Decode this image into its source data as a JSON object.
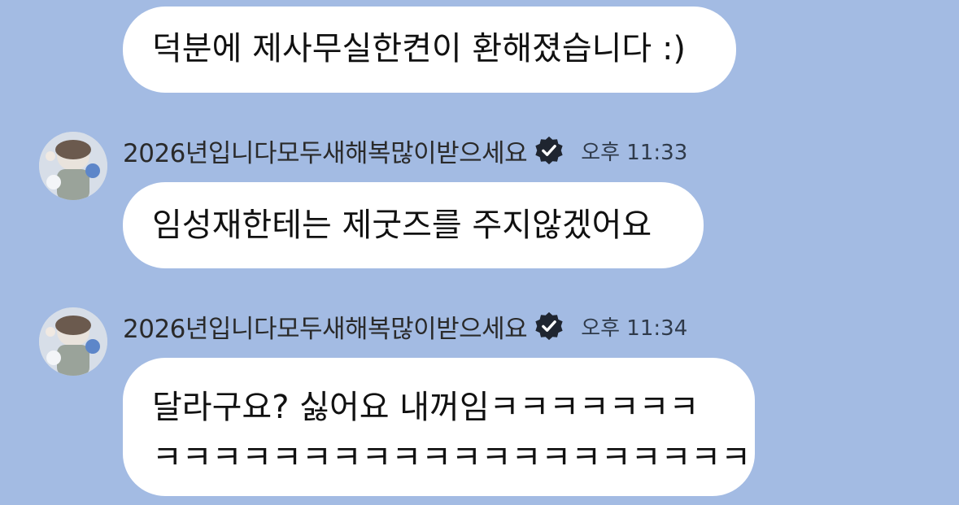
{
  "messages": [
    {
      "text": "덕분에 제사무실한켠이 환해졌습니다 :)"
    },
    {
      "sender": "2026년입니다모두새해복많이받으세요",
      "time": "오후 11:33",
      "text": "임성재한테는 제굿즈를 주지않겠어요"
    },
    {
      "sender": "2026년입니다모두새해복많이받으세요",
      "time": "오후 11:34",
      "text_line1": "달라구요? 싫어요 내꺼임ㅋㅋㅋㅋㅋㅋㅋ",
      "text_line2": "ㅋㅋㅋㅋㅋㅋㅋㅋㅋㅋㅋㅋㅋㅋㅋㅋㅋㅋㅋㅋ"
    }
  ],
  "colors": {
    "background": "#a3bbe3",
    "bubble": "#ffffff",
    "verified_badge": "#1f2530"
  },
  "icons": {
    "verified": "verified-badge-icon",
    "avatar": "profile-avatar"
  }
}
